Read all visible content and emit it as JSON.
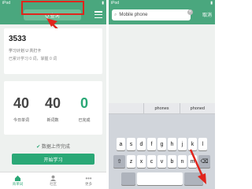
{
  "left": {
    "status": {
      "carrier": "iPod",
      "battery": "▮"
    },
    "header": {
      "search_label": "Q 查词"
    },
    "summary": {
      "word_count": "3533",
      "line_a": "学习计划 U 共打卡",
      "line_b": "已累计学习 0 词，掌握 0 词"
    },
    "stats": [
      {
        "value": "40",
        "label": "今日单词"
      },
      {
        "value": "40",
        "label": "新词数"
      },
      {
        "value": "0",
        "label": "已完成"
      }
    ],
    "sync_text": "数据上传完成",
    "start_button": "开始学习",
    "tabs": [
      {
        "label": "背单词"
      },
      {
        "label": "社区"
      },
      {
        "label": "更多"
      }
    ]
  },
  "right": {
    "status": {
      "carrier": "iPod",
      "battery": "▮"
    },
    "search_value": "Mobile phone",
    "cancel_label": "取消",
    "suggestions": [
      "phones",
      "phoned"
    ],
    "rows": [
      [
        "a",
        "s",
        "d",
        "f",
        "g",
        "h",
        "j",
        "k",
        "l"
      ],
      [
        "z",
        "x",
        "c",
        "v",
        "b",
        "n",
        "m"
      ]
    ]
  },
  "colors": {
    "accent": "#2aa876",
    "header": "#4aa77e",
    "annotation": "#e0251c"
  }
}
